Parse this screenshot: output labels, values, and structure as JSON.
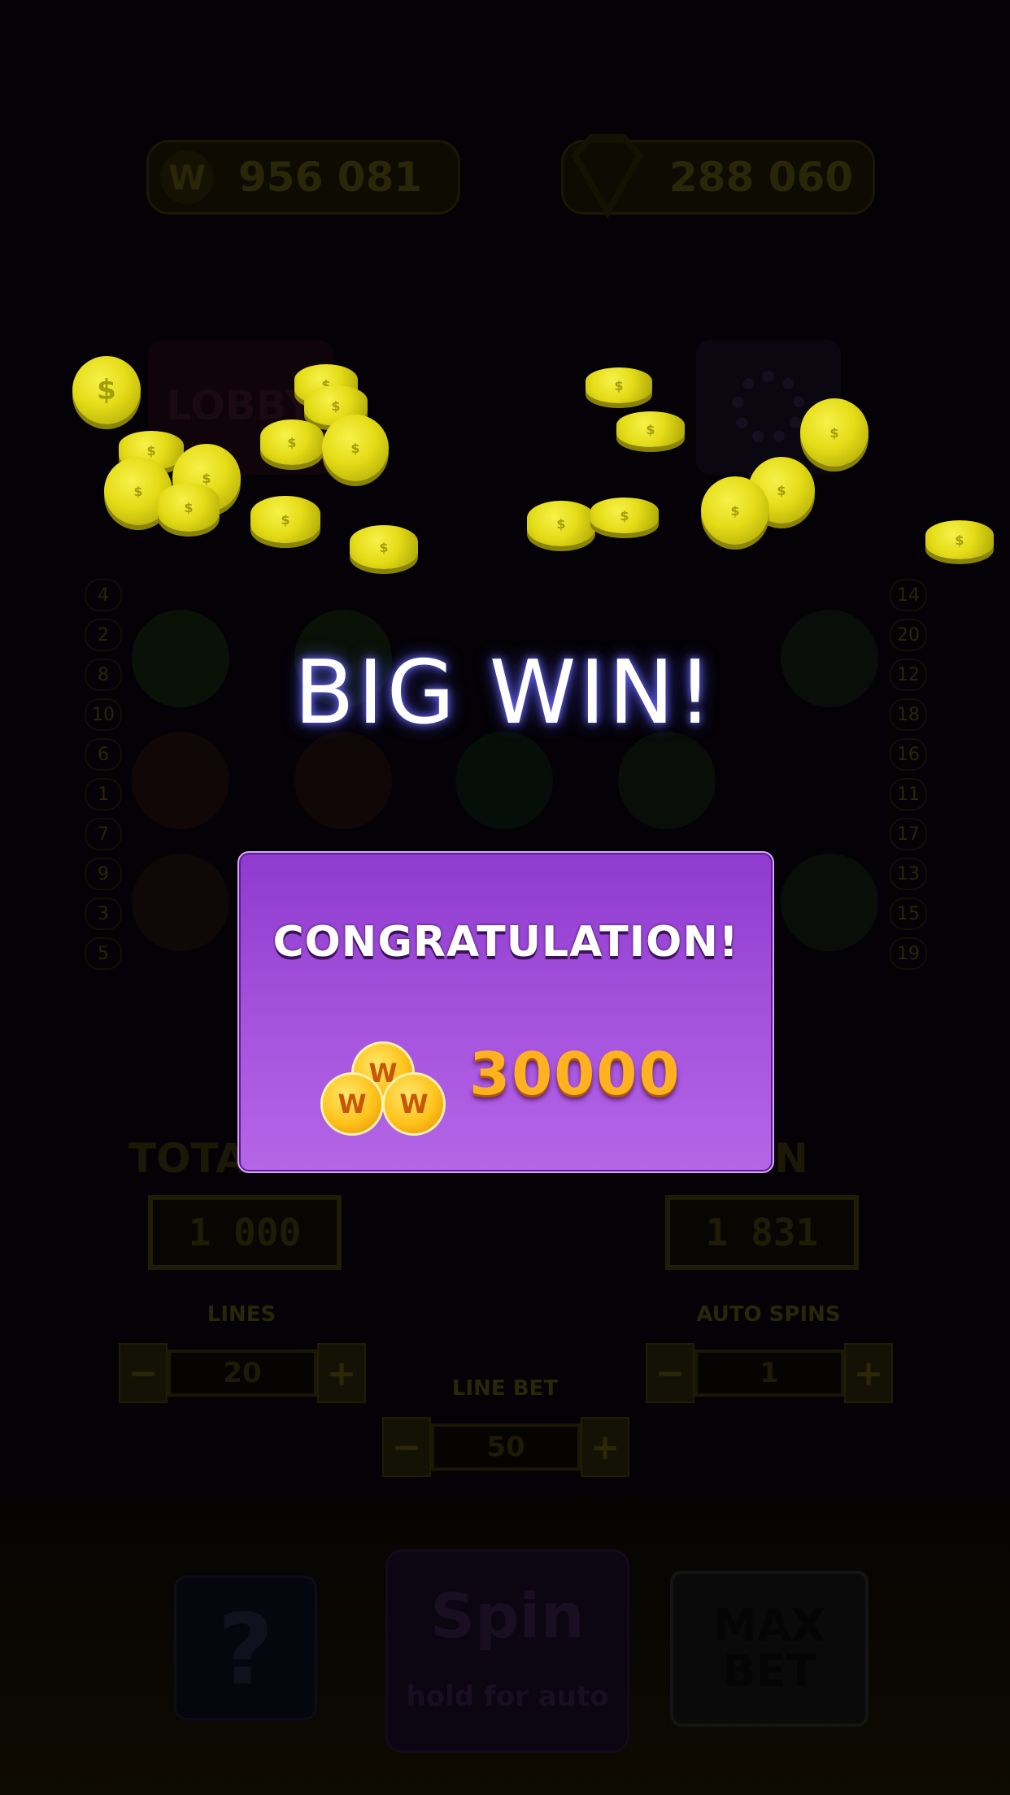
{
  "header": {
    "coins_icon": "w-coin-icon",
    "coins_value": "956 081",
    "gems_icon": "diamond-icon",
    "gems_value": "288 060"
  },
  "top_buttons": {
    "lobby_label": "LOBBY",
    "settings_icon": "gear-icon"
  },
  "reels": {
    "left_line_numbers": [
      "4",
      "2",
      "8",
      "10",
      "6",
      "1",
      "7",
      "9",
      "3",
      "5"
    ],
    "right_line_numbers": [
      "14",
      "20",
      "12",
      "18",
      "16",
      "11",
      "17",
      "13",
      "15",
      "19"
    ]
  },
  "overlay": {
    "big_win_text": "BIG WIN!",
    "popup_title": "CONGRATULATION!",
    "popup_coin_icon": "w-coins-stack-icon",
    "popup_amount": "30000",
    "falling_coin_icon": "dollar-coin-icon"
  },
  "stats": {
    "total_bet_label": "TOTA",
    "total_bet_value": "1 000",
    "win_label": "N",
    "win_value": "1 831"
  },
  "controls": {
    "lines_label": "LINES",
    "lines_value": "20",
    "auto_spins_label": "AUTO SPINS",
    "auto_spins_value": "1",
    "line_bet_label": "LINE BET",
    "line_bet_value": "50",
    "minus": "−",
    "plus": "+"
  },
  "bottom": {
    "help_label": "?",
    "spin_label": "Spin",
    "spin_sub_label": "hold for auto",
    "max_bet_label": "MAX BET"
  },
  "colors": {
    "popup_purple": "#9e4ad8",
    "amount_gold": "#ffb21f",
    "coin_yellow": "#e4dc16",
    "glow_blue": "#4b4bd8"
  }
}
